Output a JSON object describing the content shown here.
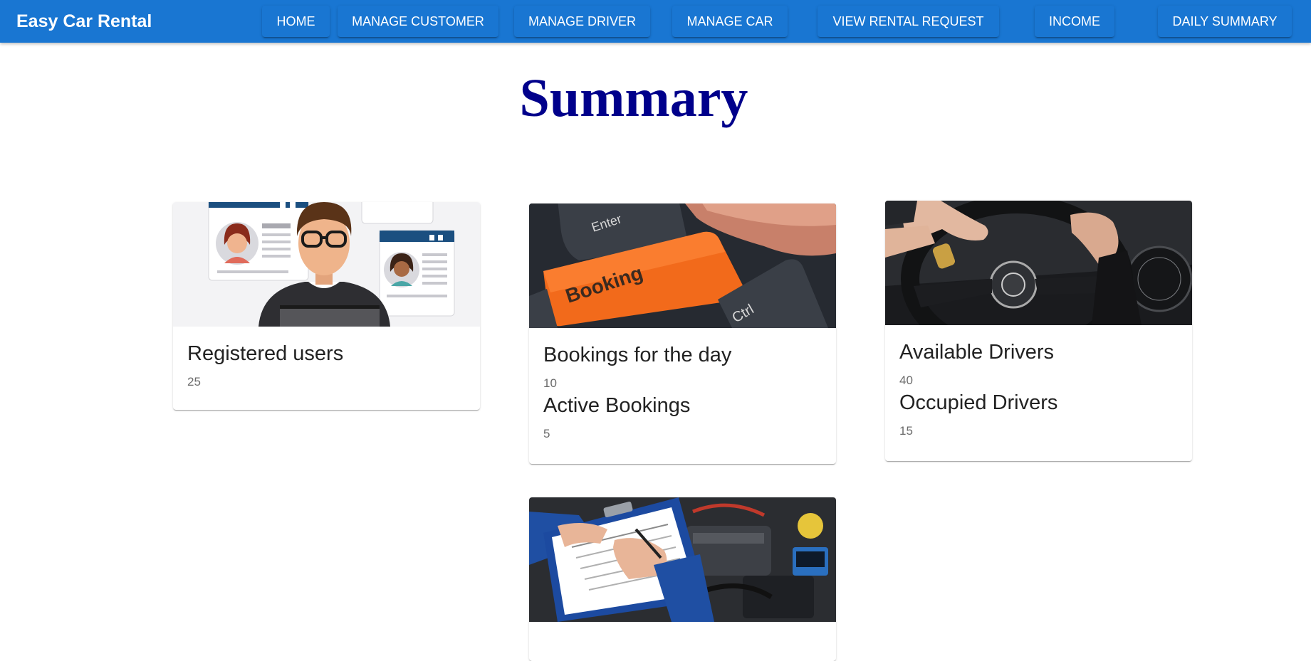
{
  "app": {
    "title": "Easy Car Rental"
  },
  "nav": {
    "home": "HOME",
    "manage_customer": "MANAGE CUSTOMER",
    "manage_driver": "MANAGE DRIVER",
    "manage_car": "MANAGE CAR",
    "view_rental_request": "VIEW RENTAL REQUEST",
    "income": "INCOME",
    "daily_summary": "DAILY SUMMARY"
  },
  "page": {
    "title": "Summary"
  },
  "cards": {
    "users": {
      "label": "Registered users",
      "value": "25"
    },
    "bookings": {
      "today_label": "Bookings for the day",
      "today_value": "10",
      "active_label": "Active Bookings",
      "active_value": "5"
    },
    "drivers": {
      "available_label": "Available Drivers",
      "available_value": "40",
      "occupied_label": "Occupied Drivers",
      "occupied_value": "15"
    }
  },
  "images": {
    "users": "users-illustration",
    "bookings": "booking-keyboard-key",
    "drivers": "hands-on-steering-wheel",
    "maintenance": "mechanic-checklist-engine"
  },
  "colors": {
    "appbar": "#1976d2",
    "title": "#00008b",
    "booking_key": "#f26a1b"
  }
}
